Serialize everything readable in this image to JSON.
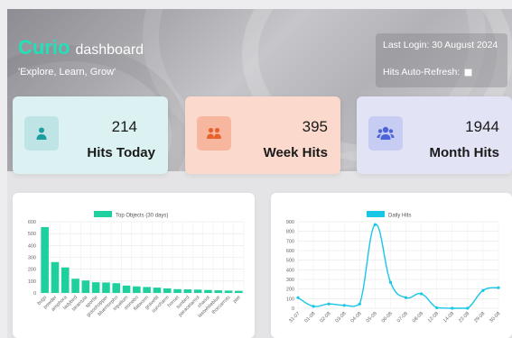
{
  "header": {
    "logo": "Curio",
    "title": "dashboard",
    "tagline": "'Explore, Learn, Grow'",
    "last_login": "Last Login: 30 August 2024",
    "auto_refresh_label": "Hits Auto-Refresh:",
    "auto_refresh_checked": false
  },
  "stats": [
    {
      "value": "214",
      "label": "Hits Today",
      "icon": "person-icon",
      "color": "#1b9ea0"
    },
    {
      "value": "395",
      "label": "Week Hits",
      "icon": "people-icon",
      "color": "#e8622c"
    },
    {
      "value": "1944",
      "label": "Month Hits",
      "icon": "users-group-icon",
      "color": "#4d63d8"
    }
  ],
  "carousel": {
    "prev": "‹",
    "next": "›"
  },
  "chart_data": [
    {
      "type": "bar",
      "legend": "Top Objects (30 days)",
      "color": "#1fd09f",
      "categories": [
        "bugs",
        "powder",
        "amphora",
        "ladybird",
        "tarantula",
        "sportle",
        "grasshopper",
        "bluemorpho",
        "tripalium",
        "stonebo",
        "flatworm",
        "gravefill",
        "suncharm",
        "hornet",
        "sunbird",
        "paracetamol",
        "chariot",
        "lastwhiteblue",
        "thorcarrots",
        "piet"
      ],
      "values": [
        555,
        260,
        215,
        120,
        105,
        90,
        88,
        82,
        62,
        55,
        50,
        45,
        38,
        32,
        30,
        28,
        25,
        22,
        20,
        18
      ],
      "ylim": [
        0,
        600
      ],
      "yticks": [
        0,
        100,
        200,
        300,
        400,
        500,
        600
      ],
      "grid": true,
      "legend_position": "top"
    },
    {
      "type": "line",
      "legend": "Daily Hits",
      "color": "#18c6e6",
      "x": [
        "31-07",
        "01-08",
        "02-08",
        "03-08",
        "04-08",
        "05-08",
        "06-08",
        "07-08",
        "08-08",
        "12-08",
        "14-08",
        "22-08",
        "29-08",
        "30-08"
      ],
      "points": [
        [
          0,
          110
        ],
        [
          1,
          20
        ],
        [
          2,
          45
        ],
        [
          3,
          30
        ],
        [
          4,
          45
        ],
        [
          5,
          870
        ],
        [
          6,
          270
        ],
        [
          7,
          110
        ],
        [
          8,
          150
        ],
        [
          9,
          5
        ],
        [
          10,
          0
        ],
        [
          11,
          0
        ],
        [
          12,
          185
        ],
        [
          13,
          214
        ]
      ],
      "ylim": [
        0,
        900
      ],
      "yticks": [
        0,
        100,
        200,
        300,
        400,
        500,
        600,
        700,
        800,
        900
      ],
      "grid": true,
      "legend_position": "top"
    }
  ]
}
